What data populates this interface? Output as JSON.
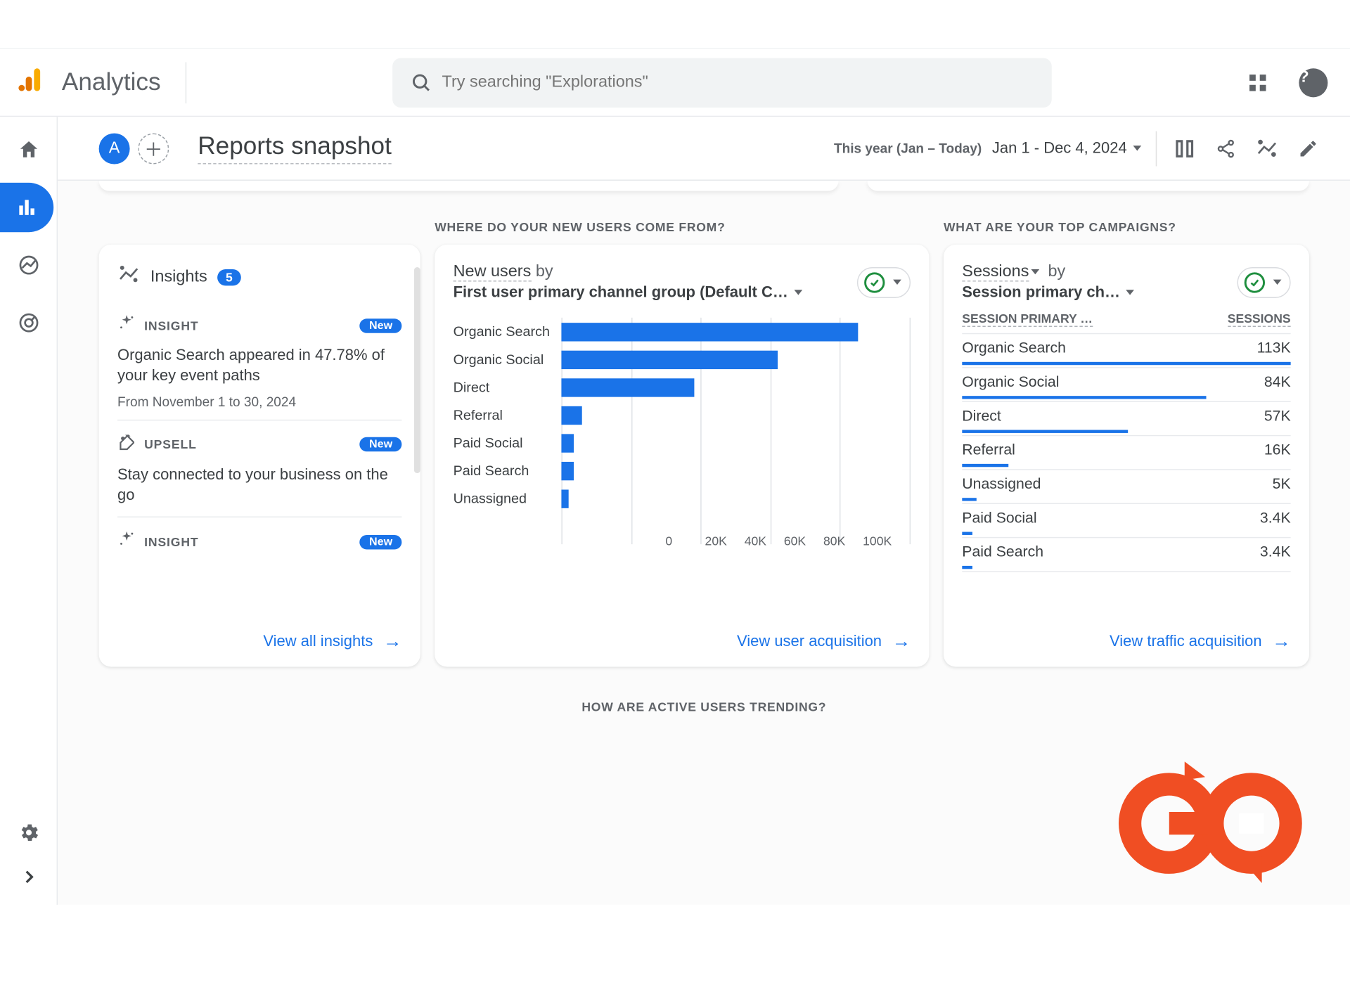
{
  "brand": {
    "name": "Analytics"
  },
  "search": {
    "placeholder": "Try searching \"Explorations\""
  },
  "page": {
    "avatar": "A",
    "title": "Reports snapshot",
    "date_label": "This year (Jan – Today)",
    "date_value": "Jan 1 - Dec 4, 2024"
  },
  "sections": {
    "new_users_label": "WHERE DO YOUR NEW USERS COME FROM?",
    "campaigns_label": "WHAT ARE YOUR TOP CAMPAIGNS?",
    "trending_label": "HOW ARE ACTIVE USERS TRENDING?"
  },
  "insights": {
    "title": "Insights",
    "count": "5",
    "items": [
      {
        "tag": "INSIGHT",
        "new": "New",
        "body": "Organic Search appeared in 47.78% of your key event paths",
        "sub": "From November 1 to 30, 2024"
      },
      {
        "tag": "UPSELL",
        "new": "New",
        "body": "Stay connected to your business on the go",
        "sub": ""
      },
      {
        "tag": "INSIGHT",
        "new": "New",
        "body": "",
        "sub": ""
      }
    ],
    "view_all": "View all insights"
  },
  "chart_data": {
    "type": "bar",
    "metric": "New users",
    "by_word": "by",
    "dimension": "First user primary channel group (Default C…",
    "categories": [
      "Organic Search",
      "Organic Social",
      "Direct",
      "Referral",
      "Paid Social",
      "Paid Search",
      "Unassigned"
    ],
    "values": [
      85000,
      62000,
      38000,
      6000,
      3500,
      3500,
      2000
    ],
    "xticks": [
      "0",
      "20K",
      "40K",
      "60K",
      "80K",
      "100K"
    ],
    "xlim": [
      0,
      100000
    ],
    "footer": "View user acquisition"
  },
  "sessions": {
    "metric": "Sessions",
    "by_word": "by",
    "dimension": "Session primary ch…",
    "col1": "SESSION PRIMARY …",
    "col2": "SESSIONS",
    "max": 113000,
    "rows": [
      {
        "label": "Organic Search",
        "display": "113K",
        "value": 113000
      },
      {
        "label": "Organic Social",
        "display": "84K",
        "value": 84000
      },
      {
        "label": "Direct",
        "display": "57K",
        "value": 57000
      },
      {
        "label": "Referral",
        "display": "16K",
        "value": 16000
      },
      {
        "label": "Unassigned",
        "display": "5K",
        "value": 5000
      },
      {
        "label": "Paid Social",
        "display": "3.4K",
        "value": 3400
      },
      {
        "label": "Paid Search",
        "display": "3.4K",
        "value": 3400
      }
    ],
    "footer": "View traffic acquisition"
  }
}
